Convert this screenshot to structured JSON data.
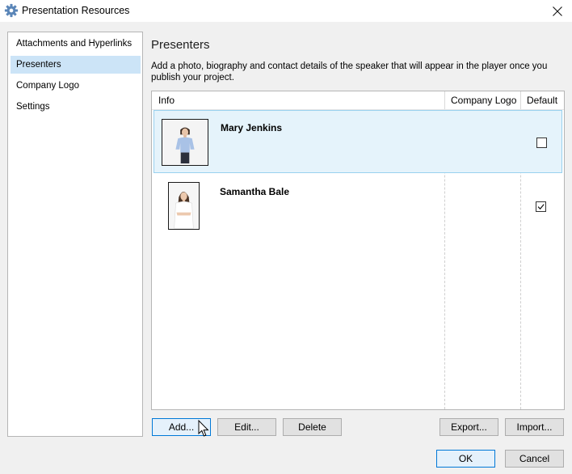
{
  "window": {
    "title": "Presentation Resources"
  },
  "nav": {
    "items": [
      {
        "label": "Attachments and Hyperlinks",
        "selected": false
      },
      {
        "label": "Presenters",
        "selected": true
      },
      {
        "label": "Company Logo",
        "selected": false
      },
      {
        "label": "Settings",
        "selected": false
      }
    ]
  },
  "content": {
    "heading": "Presenters",
    "description": "Add a photo, biography and contact details of the speaker that will appear in the player once you publish your project."
  },
  "table": {
    "columns": [
      "Info",
      "Company Logo",
      "Default"
    ],
    "rows": [
      {
        "name": "Mary Jenkins",
        "default": false,
        "selected": true
      },
      {
        "name": "Samantha Bale",
        "default": true,
        "selected": false
      }
    ]
  },
  "buttons": {
    "add": "Add...",
    "edit": "Edit...",
    "delete": "Delete",
    "export": "Export...",
    "import": "Import...",
    "ok": "OK",
    "cancel": "Cancel"
  },
  "colors": {
    "selection": "#cce4f7",
    "accent": "#0078d7",
    "gear": "#5b86b8"
  },
  "icons": {
    "app": "gear-icon",
    "close": "close-icon",
    "cursor": "mouse-pointer-icon"
  }
}
